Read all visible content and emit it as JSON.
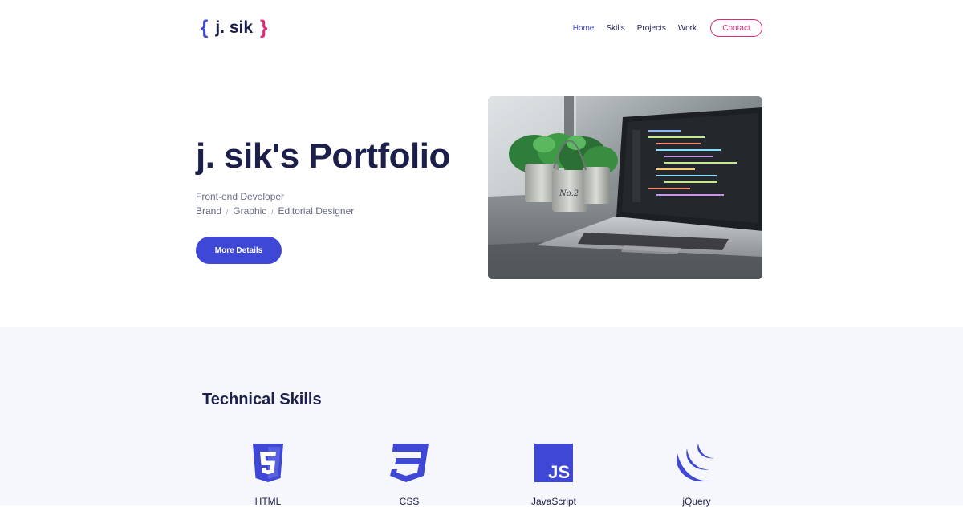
{
  "header": {
    "logo": {
      "open_brace": "{",
      "name": "j. sik",
      "close_brace": "}"
    },
    "nav": [
      {
        "label": "Home",
        "active": true
      },
      {
        "label": "Skills",
        "active": false
      },
      {
        "label": "Projects",
        "active": false
      },
      {
        "label": "Work",
        "active": false
      }
    ],
    "contact_label": "Contact"
  },
  "hero": {
    "title": "j. sik's Portfolio",
    "role": "Front-end Developer",
    "tags": [
      "Brand",
      "Graphic",
      "Editorial Designer"
    ],
    "tag_separator": "/",
    "cta_label": "More Details"
  },
  "skills": {
    "title": "Technical Skills",
    "items": [
      {
        "label": "HTML",
        "icon": "html5-icon"
      },
      {
        "label": "CSS",
        "icon": "css3-icon"
      },
      {
        "label": "JavaScript",
        "icon": "javascript-icon"
      },
      {
        "label": "jQuery",
        "icon": "jquery-icon"
      }
    ]
  },
  "colors": {
    "primary": "#3f48d6",
    "accent": "#e0287a",
    "heading": "#1b1f4a",
    "section_bg": "#f6f7fc"
  }
}
